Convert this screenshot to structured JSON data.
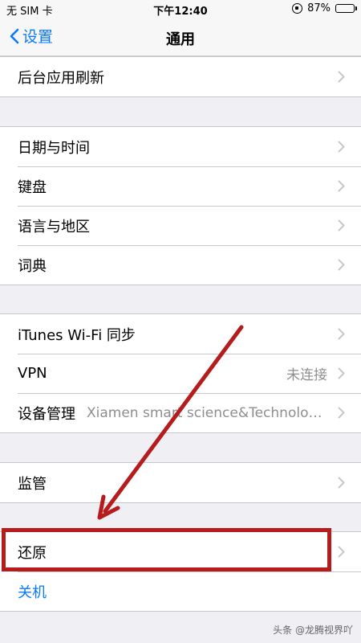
{
  "status_bar": {
    "carrier": "无 SIM 卡",
    "time": "下午12:40",
    "battery": "87%",
    "battery_level": 0.87,
    "icons": [
      "orientation-lock-icon",
      "battery-icon"
    ]
  },
  "nav": {
    "back_label": "设置",
    "title": "通用",
    "icons": [
      "chevron-left-icon"
    ]
  },
  "groups": [
    {
      "items": [
        {
          "label": "后台应用刷新"
        }
      ]
    },
    {
      "items": [
        {
          "label": "日期与时间"
        },
        {
          "label": "键盘"
        },
        {
          "label": "语言与地区"
        },
        {
          "label": "词典"
        }
      ]
    },
    {
      "items": [
        {
          "label": "iTunes Wi-Fi 同步"
        },
        {
          "label": "VPN",
          "detail": "未连接"
        },
        {
          "label": "设备管理",
          "detail": "Xiamen smart science&Technolog..."
        }
      ]
    },
    {
      "items": [
        {
          "label": "监管"
        }
      ]
    },
    {
      "items": [
        {
          "label": "还原"
        },
        {
          "label": "关机"
        }
      ]
    }
  ],
  "colors": {
    "accent": "#0a7aff",
    "annotation": "#b71c1c",
    "background": "#efeff4"
  },
  "watermark": "头条 @龙腾视界吖"
}
